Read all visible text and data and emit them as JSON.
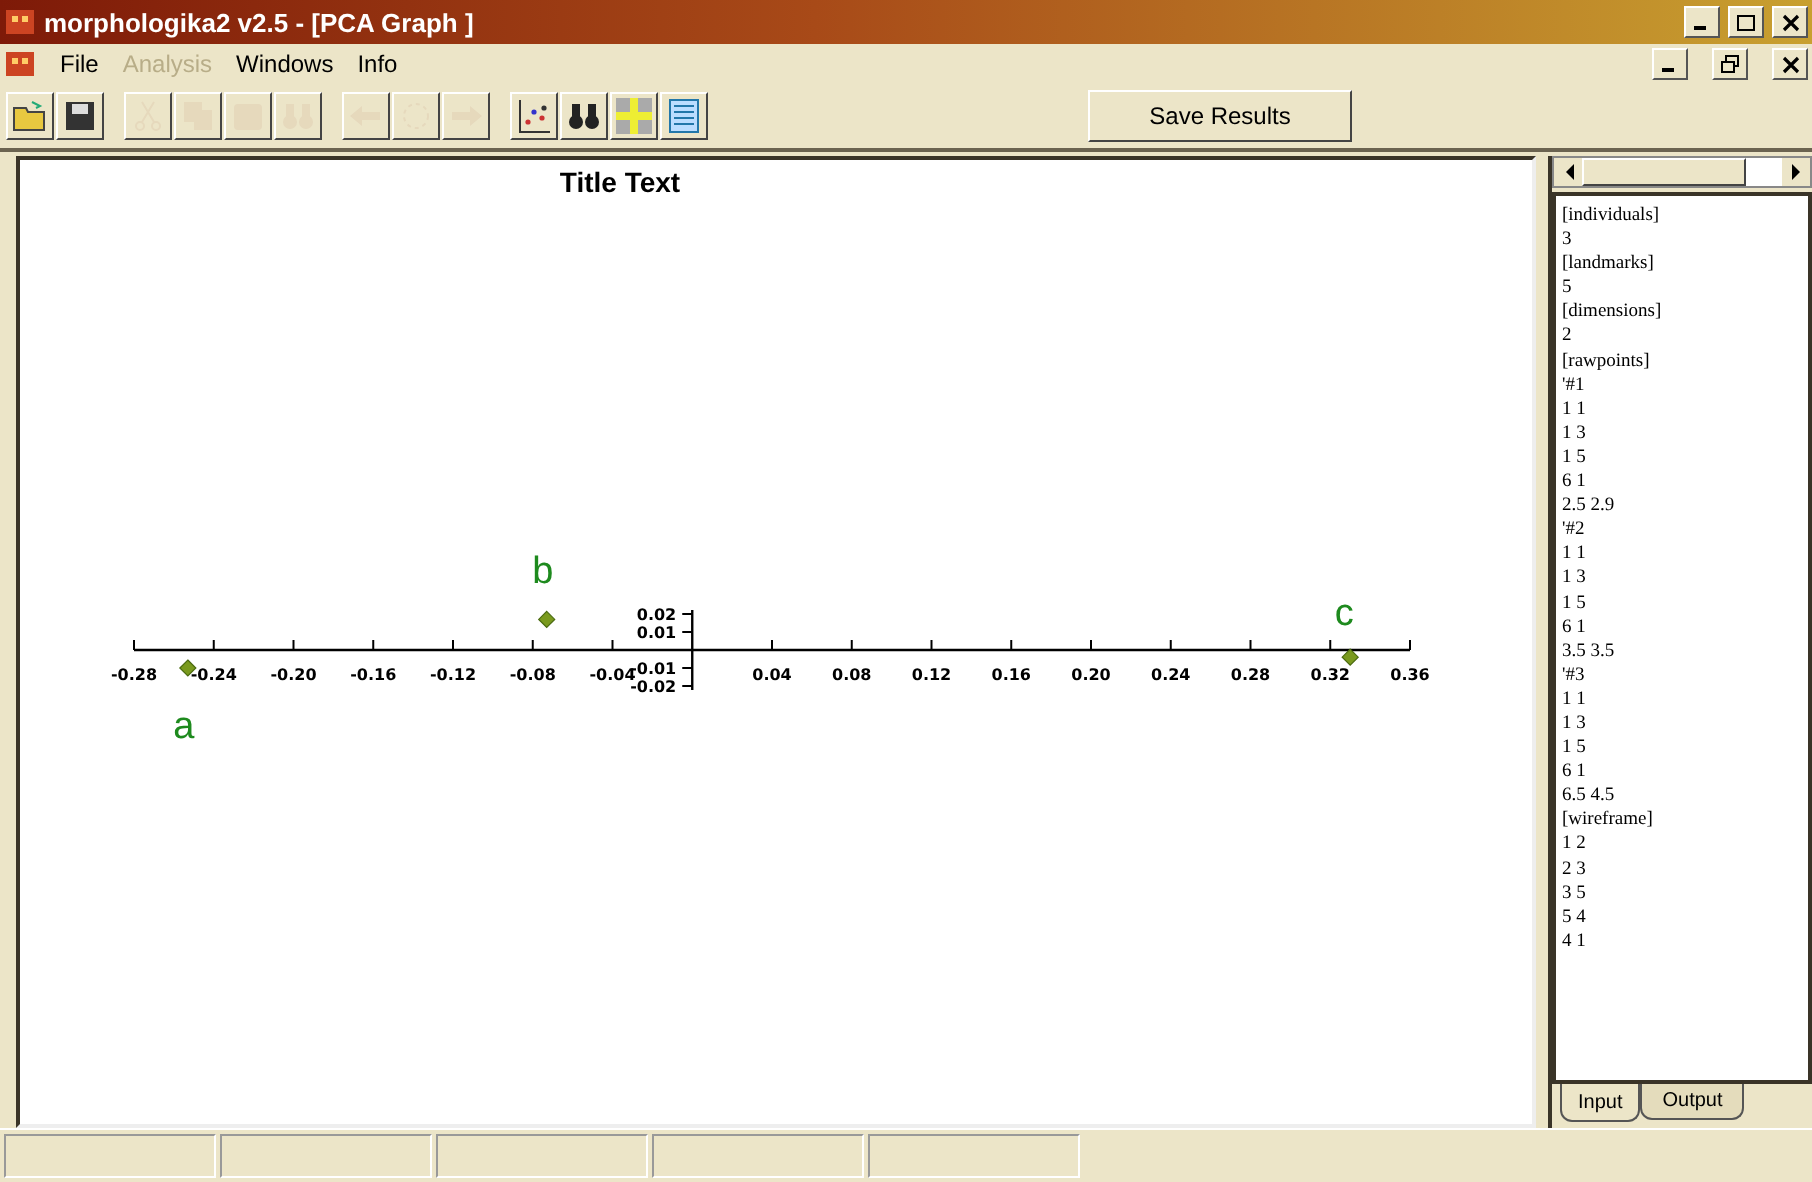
{
  "window": {
    "title": "morphologika2 v2.5 - [PCA Graph ]"
  },
  "menu": [
    {
      "label": "File",
      "disabled": false
    },
    {
      "label": "Analysis",
      "disabled": true
    },
    {
      "label": "Windows",
      "disabled": false
    },
    {
      "label": "Info",
      "disabled": false
    }
  ],
  "toolbar": [
    {
      "kind": "open",
      "disabled": false
    },
    {
      "kind": "save",
      "disabled": false
    },
    {
      "kind": "cut",
      "disabled": true
    },
    {
      "kind": "copy",
      "disabled": true
    },
    {
      "kind": "paste",
      "disabled": true
    },
    {
      "kind": "find",
      "disabled": true
    },
    {
      "kind": "back",
      "disabled": true
    },
    {
      "kind": "rotate",
      "disabled": true
    },
    {
      "kind": "forward",
      "disabled": true
    },
    {
      "kind": "scatter",
      "disabled": false
    },
    {
      "kind": "binoculars",
      "disabled": false
    },
    {
      "kind": "crosshair",
      "disabled": false
    },
    {
      "kind": "list",
      "disabled": false
    }
  ],
  "save_button": "Save Results",
  "graph": {
    "chart_data": {
      "type": "scatter",
      "title": "Title Text",
      "x": [
        -0.253,
        -0.073,
        0.33
      ],
      "series": [
        {
          "color": "#7a9a1e",
          "values": [
            -0.01,
            0.017,
            -0.004
          ]
        }
      ],
      "xlim": [
        -0.28,
        0.36
      ],
      "ylim": [
        -0.02,
        0.02
      ],
      "xticks": [
        {
          "value": -0.28,
          "label": "-0.28"
        },
        {
          "value": -0.24,
          "label": "-0.24"
        },
        {
          "value": -0.2,
          "label": "-0.20"
        },
        {
          "value": -0.16,
          "label": "-0.16"
        },
        {
          "value": -0.12,
          "label": "-0.12"
        },
        {
          "value": -0.08,
          "label": "-0.08"
        },
        {
          "value": -0.04,
          "label": "-0.04"
        },
        {
          "value": 0.04,
          "label": "0.04"
        },
        {
          "value": 0.08,
          "label": "0.08"
        },
        {
          "value": 0.12,
          "label": "0.12"
        },
        {
          "value": 0.16,
          "label": "0.16"
        },
        {
          "value": 0.2,
          "label": "0.20"
        },
        {
          "value": 0.24,
          "label": "0.24"
        },
        {
          "value": 0.28,
          "label": "0.28"
        },
        {
          "value": 0.32,
          "label": "0.32"
        },
        {
          "value": 0.36,
          "label": "0.36"
        }
      ],
      "yticks": [
        {
          "value": 0.02,
          "label": "0.02"
        },
        {
          "value": 0.01,
          "label": "0.01"
        },
        {
          "value": -0.01,
          "label": "-0.01"
        },
        {
          "value": -0.02,
          "label": "-0.02"
        }
      ],
      "annotations": [
        "a",
        "b",
        "c"
      ]
    }
  },
  "side_panel": {
    "lines": [
      "[individuals]",
      "3",
      "[landmarks]",
      "5",
      "[dimensions]",
      "2",
      "[rawpoints]",
      "'#1",
      "1 1",
      "1 3",
      "1 5",
      "6 1",
      "2.5 2.9",
      "'#2",
      "1 1",
      "1 3",
      "1 5",
      "6 1",
      "3.5 3.5",
      "'#3",
      "1 1",
      "1 3",
      "1 5",
      "6 1",
      "6.5 4.5",
      "[wireframe]",
      "1 2",
      "2 3",
      "3 5",
      "5 4",
      "4 1"
    ],
    "tabs": [
      {
        "label": "Input",
        "selected": true
      },
      {
        "label": "Output",
        "selected": false
      }
    ]
  }
}
